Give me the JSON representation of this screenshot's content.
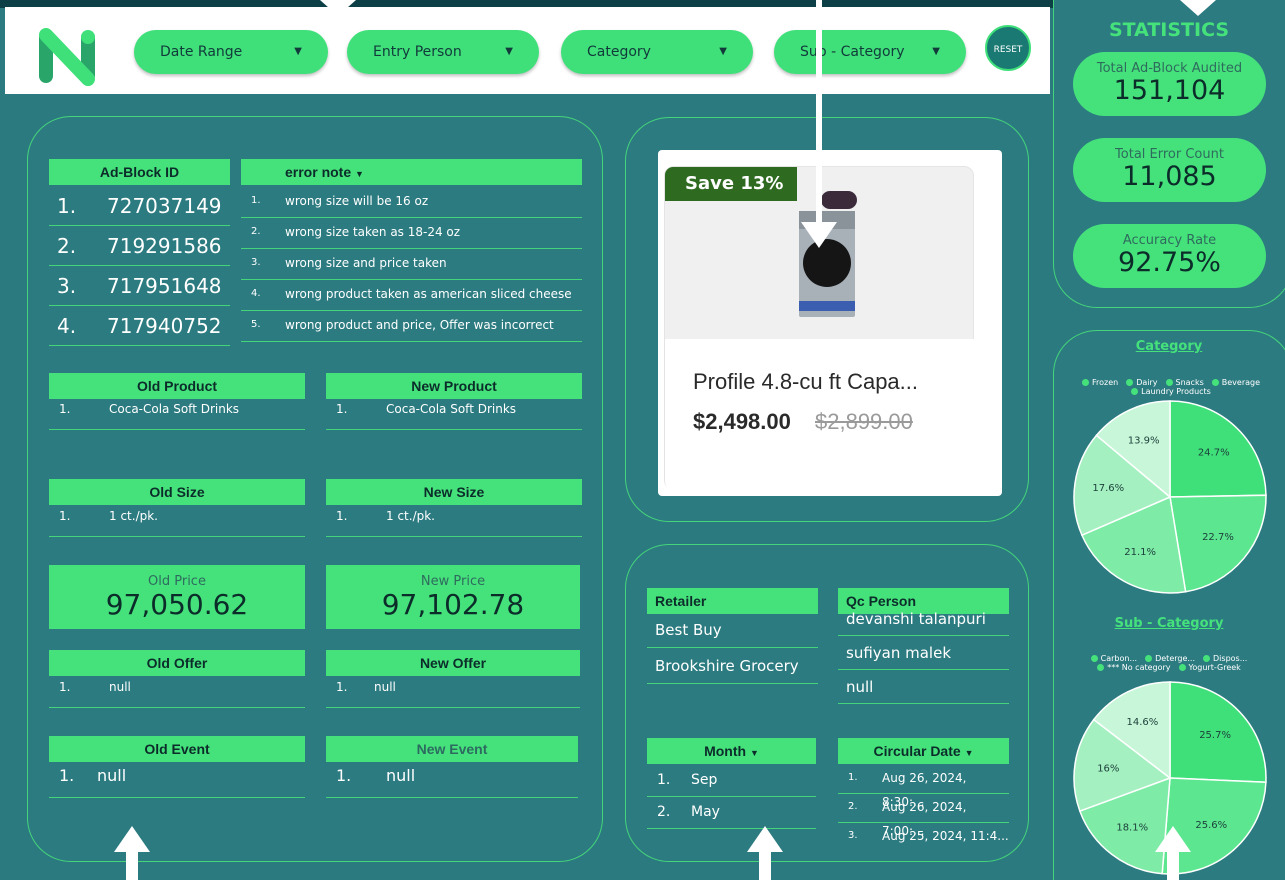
{
  "filters": {
    "date_range": "Date Range",
    "entry_person": "Entry Person",
    "category": "Category",
    "sub_category": "Sub - Category",
    "reset": "RESET"
  },
  "left_panel": {
    "ad_block_header": "Ad-Block ID",
    "error_note_header": "error note",
    "ad_blocks": [
      {
        "n": "1.",
        "id": "727037149"
      },
      {
        "n": "2.",
        "id": "719291586"
      },
      {
        "n": "3.",
        "id": "717951648"
      },
      {
        "n": "4.",
        "id": "717940752"
      }
    ],
    "error_notes": [
      {
        "n": "1.",
        "text": "wrong size will be 16 oz"
      },
      {
        "n": "2.",
        "text": "wrong size taken as 18-24 oz"
      },
      {
        "n": "3.",
        "text": "wrong size and price taken"
      },
      {
        "n": "4.",
        "text": "wrong product taken as american sliced cheese"
      },
      {
        "n": "5.",
        "text": "wrong product and price, Offer was incorrect"
      }
    ],
    "old_product_header": "Old Product",
    "new_product_header": "New Product",
    "old_product": {
      "n": "1.",
      "text": "Coca-Cola Soft Drinks"
    },
    "new_product": {
      "n": "1.",
      "text": "Coca-Cola Soft Drinks"
    },
    "old_size_header": "Old Size",
    "new_size_header": "New Size",
    "old_size": {
      "n": "1.",
      "text": "1 ct./pk."
    },
    "new_size": {
      "n": "1.",
      "text": "1 ct./pk."
    },
    "old_price_label": "Old Price",
    "old_price_value": "97,050.62",
    "new_price_label": "New Price",
    "new_price_value": "97,102.78",
    "old_offer_header": "Old Offer",
    "new_offer_header": "New Offer",
    "old_offer": {
      "n": "1.",
      "text": "null"
    },
    "new_offer": {
      "n": "1.",
      "text": "null"
    },
    "old_event_header": "Old Event",
    "new_event_header": "New Event",
    "old_event": {
      "n": "1.",
      "text": "null"
    },
    "new_event": {
      "n": "1.",
      "text": "null"
    }
  },
  "product": {
    "badge": "Save 13%",
    "title": "Profile 4.8-cu ft Capa...",
    "price": "$2,498.00",
    "old_price": "$2,899.00"
  },
  "retail_panel": {
    "retailer_header": "Retailer",
    "retailers": [
      "Best Buy",
      "Brookshire Grocery"
    ],
    "qc_header": "Qc Person",
    "qc_people": [
      "devanshi talanpuri",
      "sufiyan malek",
      "null"
    ],
    "month_header": "Month",
    "months": [
      {
        "n": "1.",
        "text": "Sep"
      },
      {
        "n": "2.",
        "text": "May"
      }
    ],
    "circular_header": "Circular Date",
    "circular_dates": [
      {
        "n": "1.",
        "text": "Aug 26, 2024, 8:30:..."
      },
      {
        "n": "2.",
        "text": "Aug 26, 2024, 7:00:..."
      },
      {
        "n": "3.",
        "text": "Aug 25, 2024, 11:4..."
      }
    ]
  },
  "stats": {
    "title": "STATISTICS",
    "items": [
      {
        "label": "Total Ad-Block Audited",
        "value": "151,104"
      },
      {
        "label": "Total Error Count",
        "value": "11,085"
      },
      {
        "label": "Accuracy Rate",
        "value": "92.75%"
      }
    ]
  },
  "colors": {
    "accent": "#45e27c",
    "background": "#2b7a80",
    "dark": "#0d3f47"
  },
  "chart_data": [
    {
      "type": "pie",
      "title": "Category",
      "legend": [
        "Frozen",
        "Dairy",
        "Snacks",
        "Beverage",
        "Laundry Products"
      ],
      "slices": [
        {
          "label": "24.7%",
          "value": 24.7
        },
        {
          "label": "22.7%",
          "value": 22.7
        },
        {
          "label": "21.1%",
          "value": 21.1
        },
        {
          "label": "17.6%",
          "value": 17.6
        },
        {
          "label": "13.9%",
          "value": 13.9
        }
      ],
      "colors": [
        "#3fe07a",
        "#5ce68f",
        "#7eeba7",
        "#a4f0c0",
        "#c8f6d8"
      ]
    },
    {
      "type": "pie",
      "title": "Sub - Category",
      "legend": [
        "Carbon...",
        "Deterge...",
        "Dispos...",
        "*** No category",
        "Yogurt-Greek"
      ],
      "slices": [
        {
          "label": "25.7%",
          "value": 25.7
        },
        {
          "label": "25.6%",
          "value": 25.6
        },
        {
          "label": "18.1%",
          "value": 18.1
        },
        {
          "label": "16%",
          "value": 16.0
        },
        {
          "label": "14.6%",
          "value": 14.6
        }
      ],
      "colors": [
        "#3fe07a",
        "#5ce68f",
        "#7eeba7",
        "#a4f0c0",
        "#c8f6d8"
      ]
    }
  ]
}
